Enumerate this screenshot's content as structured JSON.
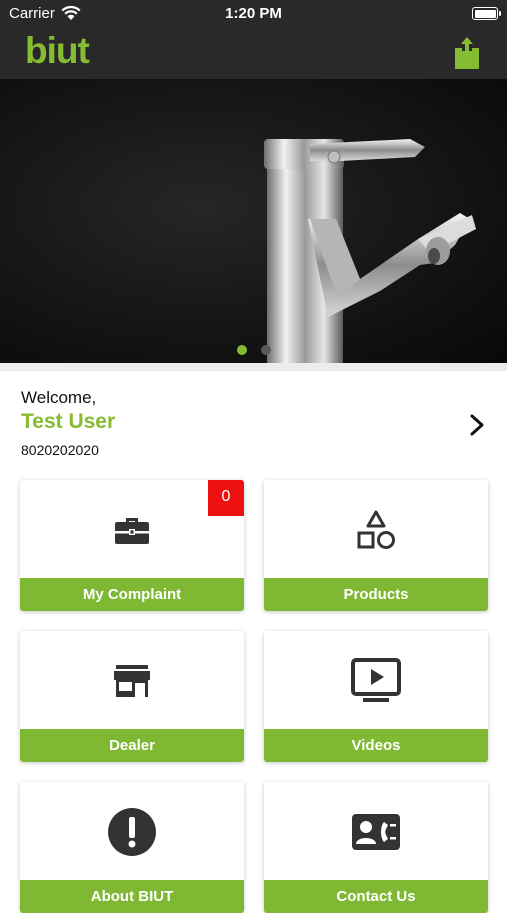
{
  "status_bar": {
    "carrier": "Carrier",
    "time": "1:20 PM"
  },
  "header": {
    "logo": "biut",
    "share_icon": "share-icon"
  },
  "banner": {
    "slide_count": 2,
    "active_slide": 1
  },
  "user": {
    "welcome": "Welcome,",
    "name": "Test User",
    "phone": "8020202020"
  },
  "tiles": [
    {
      "label": "My Complaint",
      "icon": "briefcase-icon",
      "badge": "0"
    },
    {
      "label": "Products",
      "icon": "shapes-icon"
    },
    {
      "label": "Dealer",
      "icon": "store-icon"
    },
    {
      "label": "Videos",
      "icon": "video-icon"
    },
    {
      "label": "About BIUT",
      "icon": "info-icon"
    },
    {
      "label": "Contact Us",
      "icon": "contact-icon"
    }
  ],
  "colors": {
    "accent": "#86bc32",
    "tile_bar": "#7fb933",
    "header_bg": "#292929",
    "badge": "#ee1111"
  }
}
